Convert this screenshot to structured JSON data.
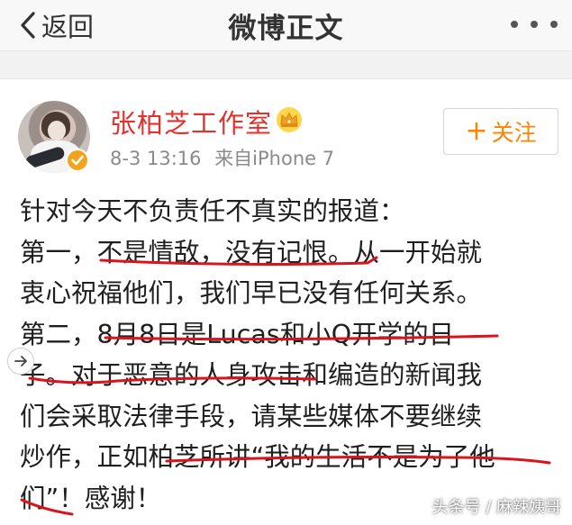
{
  "navbar": {
    "back_label": "返回",
    "title": "微博正文",
    "more_icon": "more-dots-icon"
  },
  "author": {
    "name": "张柏芝工作室",
    "badge_icon": "crown-member-icon",
    "verified_icon": "verified-badge-icon",
    "time": "8-3 13:16",
    "source": "来自iPhone 7",
    "follow_label": "关注"
  },
  "post": {
    "lines": [
      "针对今天不负责任不真实的报道：",
      "第一，不是情敌，没有记恨。从一开始就",
      "衷心祝福他们，我们早已没有任何关系。",
      "第二，8月8日是Lucas和小Q开学的日",
      "子。对于恶意的人身攻击和编造的新闻我",
      "们会采取法律手段，请某些媒体不要继续",
      "炒作，正如柏芝所讲“我的生活不是为了他",
      "们”！感谢！"
    ]
  },
  "watermark": "头条号 / 麻辣姨哥",
  "colors": {
    "username": "#e3312d",
    "follow": "#ff8200",
    "underline": "#d8141c",
    "meta": "#8a8a8a"
  }
}
